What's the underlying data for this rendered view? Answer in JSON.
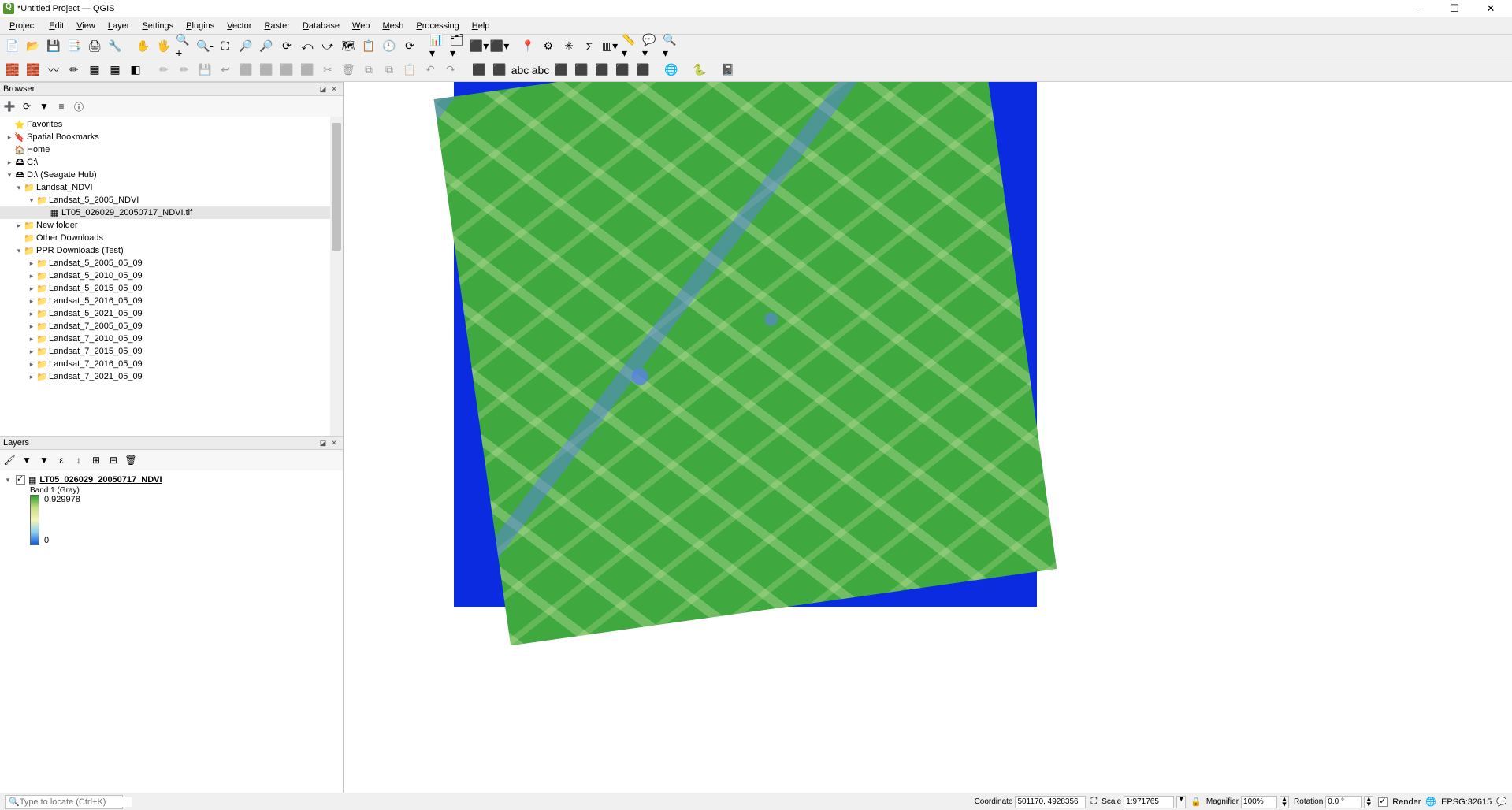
{
  "window": {
    "title": "*Untitled Project — QGIS"
  },
  "menu": [
    "Project",
    "Edit",
    "View",
    "Layer",
    "Settings",
    "Plugins",
    "Vector",
    "Raster",
    "Database",
    "Web",
    "Mesh",
    "Processing",
    "Help"
  ],
  "panels": {
    "browser": "Browser",
    "layers": "Layers"
  },
  "browser_tree": [
    {
      "depth": 0,
      "twist": "",
      "icon": "⭐",
      "label": "Favorites"
    },
    {
      "depth": 0,
      "twist": "▸",
      "icon": "🔖",
      "label": "Spatial Bookmarks"
    },
    {
      "depth": 0,
      "twist": "",
      "icon": "🏠",
      "label": "Home"
    },
    {
      "depth": 0,
      "twist": "▸",
      "icon": "🖴",
      "label": "C:\\"
    },
    {
      "depth": 0,
      "twist": "▾",
      "icon": "🖴",
      "label": "D:\\ (Seagate Hub)"
    },
    {
      "depth": 1,
      "twist": "▾",
      "icon": "📁",
      "label": "Landsat_NDVI"
    },
    {
      "depth": 2,
      "twist": "▾",
      "icon": "📁",
      "label": "Landsat_5_2005_NDVI"
    },
    {
      "depth": 3,
      "twist": "",
      "icon": "▦",
      "label": "LT05_026029_20050717_NDVI.tif",
      "sel": true
    },
    {
      "depth": 1,
      "twist": "▸",
      "icon": "📁",
      "label": "New folder"
    },
    {
      "depth": 1,
      "twist": "",
      "icon": "📁",
      "label": "Other Downloads"
    },
    {
      "depth": 1,
      "twist": "▾",
      "icon": "📁",
      "label": "PPR Downloads (Test)"
    },
    {
      "depth": 2,
      "twist": "▸",
      "icon": "📁",
      "label": "Landsat_5_2005_05_09"
    },
    {
      "depth": 2,
      "twist": "▸",
      "icon": "📁",
      "label": "Landsat_5_2010_05_09"
    },
    {
      "depth": 2,
      "twist": "▸",
      "icon": "📁",
      "label": "Landsat_5_2015_05_09"
    },
    {
      "depth": 2,
      "twist": "▸",
      "icon": "📁",
      "label": "Landsat_5_2016_05_09"
    },
    {
      "depth": 2,
      "twist": "▸",
      "icon": "📁",
      "label": "Landsat_5_2021_05_09"
    },
    {
      "depth": 2,
      "twist": "▸",
      "icon": "📁",
      "label": "Landsat_7_2005_05_09"
    },
    {
      "depth": 2,
      "twist": "▸",
      "icon": "📁",
      "label": "Landsat_7_2010_05_09"
    },
    {
      "depth": 2,
      "twist": "▸",
      "icon": "📁",
      "label": "Landsat_7_2015_05_09"
    },
    {
      "depth": 2,
      "twist": "▸",
      "icon": "📁",
      "label": "Landsat_7_2016_05_09"
    },
    {
      "depth": 2,
      "twist": "▸",
      "icon": "📁",
      "label": "Landsat_7_2021_05_09"
    }
  ],
  "layer": {
    "name": "LT05_026029_20050717_NDVI",
    "band": "Band 1 (Gray)",
    "max": "0.929978",
    "min": "0"
  },
  "status": {
    "locate_placeholder": "Type to locate (Ctrl+K)",
    "coord_label": "Coordinate",
    "coord_value": "501170, 4928356",
    "scale_label": "Scale",
    "scale_value": "1:971765",
    "magnifier_label": "Magnifier",
    "magnifier_value": "100%",
    "rotation_label": "Rotation",
    "rotation_value": "0.0 °",
    "render_label": "Render",
    "crs": "EPSG:32615"
  },
  "tb1": [
    "📄",
    "📂",
    "💾",
    "📑",
    "🖨",
    "🔧",
    "",
    "✋",
    "🖐",
    "🔍+",
    "🔍-",
    "⛶",
    "🔎",
    "🔎",
    "⟳",
    "⤺",
    "⤻",
    "🗺",
    "📋",
    "🕘",
    "⟳",
    "",
    "📊▾",
    "🗂▾",
    "⬛▾",
    "⬛▾",
    "",
    "📍",
    "⚙",
    "✳",
    "Σ",
    "▥▾",
    "📏▾",
    "💬▾",
    "🔍▾"
  ],
  "tb2": [
    "🧱",
    "🧱",
    "〰",
    "✏",
    "▦",
    "▦",
    "◧",
    "",
    "✏",
    "✏",
    "💾",
    "↩",
    "⬛",
    "⬛",
    "⬛",
    "⬛",
    "✂",
    "🗑",
    "⧉",
    "⧉",
    "📋",
    "↶",
    "↷",
    "",
    "⬛",
    "⬛",
    "abc",
    "abc",
    "⬛",
    "⬛",
    "⬛",
    "⬛",
    "⬛",
    "",
    "🌐",
    "",
    "🐍",
    "",
    "📓"
  ]
}
